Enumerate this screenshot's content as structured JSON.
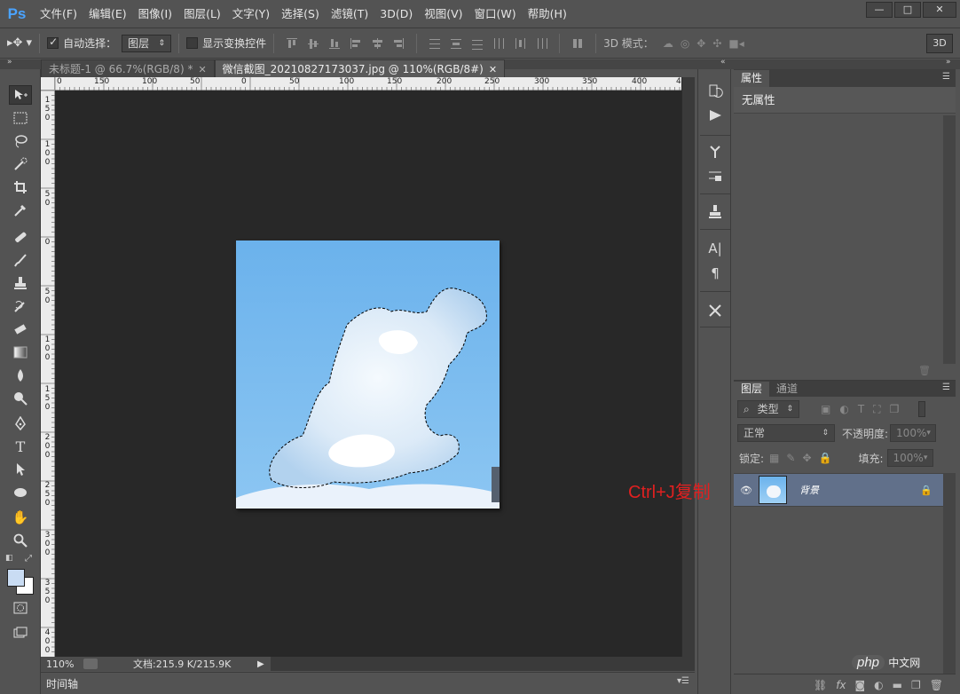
{
  "app": {
    "logo": "Ps"
  },
  "menu": [
    "文件(F)",
    "编辑(E)",
    "图像(I)",
    "图层(L)",
    "文字(Y)",
    "选择(S)",
    "滤镜(T)",
    "3D(D)",
    "视图(V)",
    "窗口(W)",
    "帮助(H)"
  ],
  "options": {
    "auto_select_label": "自动选择：",
    "auto_select_checked": true,
    "auto_select_value": "图层",
    "show_transform_label": "显示变换控件",
    "mode_3d_label": "3D 模式：",
    "btn_3d": "3D"
  },
  "tabs": [
    {
      "label": "未标题-1 @ 66.7%(RGB/8) *",
      "active": false
    },
    {
      "label": "微信截图_20210827173037.jpg @ 110%(RGB/8#)",
      "active": true
    }
  ],
  "ruler": {
    "h_labels": [
      "0",
      "150",
      "100",
      "50",
      "0",
      "50",
      "100",
      "150",
      "200",
      "250",
      "300",
      "350",
      "400",
      "4"
    ],
    "v_labels": [
      "150",
      "100",
      "50",
      "0",
      "50",
      "100",
      "150",
      "200",
      "250",
      "300",
      "350",
      "400"
    ]
  },
  "status": {
    "zoom": "110%",
    "doc_info": "文档:215.9 K/215.9K"
  },
  "timeline": {
    "label": "时间轴"
  },
  "properties": {
    "tab": "属性",
    "content": "无属性"
  },
  "layers": {
    "tabs": [
      "图层",
      "通道"
    ],
    "kind_label": "类型",
    "blend_mode": "正常",
    "opacity_label": "不透明度:",
    "opacity_value": "100%",
    "lock_label": "锁定:",
    "fill_label": "填充:",
    "fill_value": "100%",
    "items": [
      {
        "name": "背景",
        "visible": true,
        "locked": true
      }
    ]
  },
  "annotation": "Ctrl+J复制",
  "watermark": {
    "brand": "php",
    "site": "中文网"
  },
  "colors": {
    "accent": "#4aa3ff",
    "annotation": "#e02020",
    "layer_selected": "#61708a",
    "canvas_bg": "#282828"
  }
}
